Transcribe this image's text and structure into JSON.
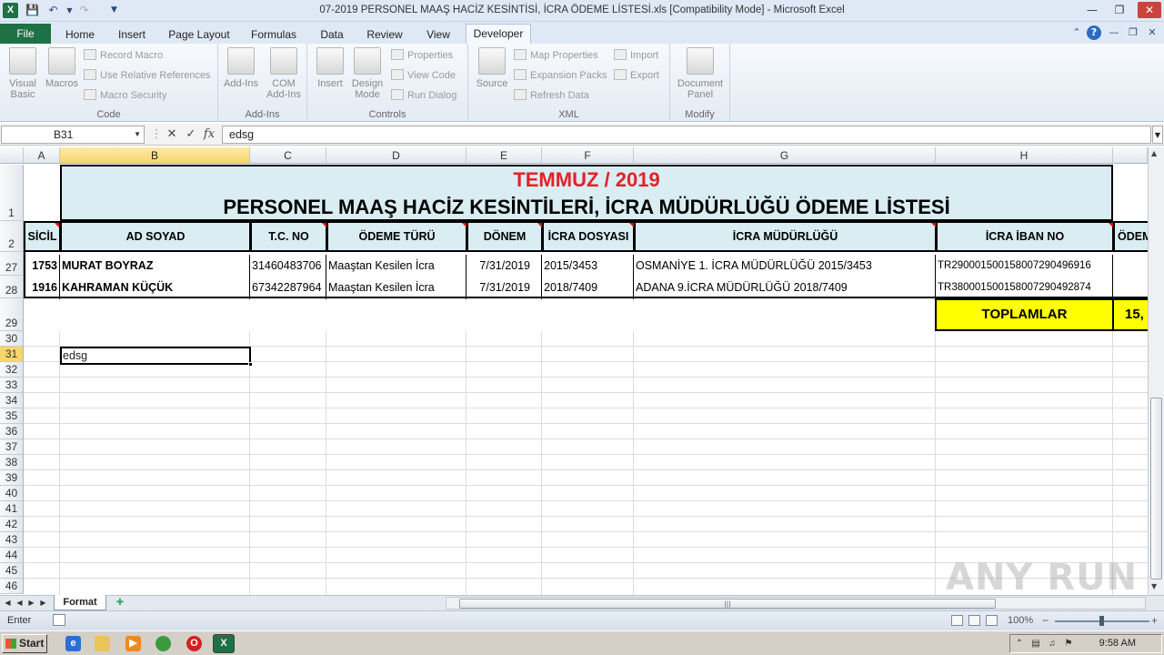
{
  "window": {
    "title": "07-2019 PERSONEL MAAŞ HACİZ KESİNTİSİ, İCRA ÖDEME LİSTESİ.xls  [Compatibility Mode]  -  Microsoft Excel",
    "app_icon": "X"
  },
  "tabs": {
    "file": "File",
    "items": [
      "Home",
      "Insert",
      "Page Layout",
      "Formulas",
      "Data",
      "Review",
      "View",
      "Developer"
    ],
    "active": "Developer"
  },
  "ribbon": {
    "code": {
      "label": "Code",
      "visual_basic": "Visual Basic",
      "macros": "Macros",
      "record_macro": "Record Macro",
      "use_relative": "Use Relative References",
      "macro_security": "Macro Security"
    },
    "addins": {
      "label": "Add-Ins",
      "addins": "Add-Ins",
      "com_addins": "COM Add-Ins"
    },
    "controls": {
      "label": "Controls",
      "insert": "Insert",
      "design_mode": "Design Mode",
      "properties": "Properties",
      "view_code": "View Code",
      "run_dialog": "Run Dialog"
    },
    "xml": {
      "label": "XML",
      "source": "Source",
      "map_properties": "Map Properties",
      "expansion_packs": "Expansion Packs",
      "refresh_data": "Refresh Data",
      "import": "Import",
      "export": "Export"
    },
    "modify": {
      "label": "Modify",
      "document_panel": "Document Panel"
    }
  },
  "formula_bar": {
    "name_box": "B31",
    "value": "edsg",
    "fx": "fx"
  },
  "columns": [
    "A",
    "B",
    "C",
    "D",
    "E",
    "F",
    "G",
    "H"
  ],
  "rows": [
    "1",
    "2",
    "27",
    "28",
    "29",
    "30",
    "31",
    "32",
    "33",
    "34",
    "35",
    "36",
    "37",
    "38",
    "39",
    "40",
    "41",
    "42",
    "43",
    "44",
    "45",
    "46"
  ],
  "sheet": {
    "title_line1": "TEMMUZ / 2019",
    "title_line2": "PERSONEL MAAŞ HACİZ KESİNTİLERİ, İCRA MÜDÜRLÜĞÜ ÖDEME LİSTESİ",
    "headers": [
      "SİCİL",
      "AD SOYAD",
      "T.C. NO",
      "ÖDEME TÜRÜ",
      "DÖNEM",
      "İCRA DOSYASI",
      "İCRA MÜDÜRLÜĞÜ",
      "İCRA İBAN NO",
      "ÖDEM"
    ],
    "rows": [
      [
        "1753",
        "MURAT BOYRAZ",
        "31460483706",
        "Maaştan Kesilen İcra",
        "7/31/2019",
        "2015/3453",
        "OSMANİYE 1. İCRA MÜDÜRLÜĞÜ 2015/3453",
        "TR290001500158007290496916"
      ],
      [
        "1916",
        "KAHRAMAN KÜÇÜK",
        "67342287964",
        "Maaştan Kesilen İcra",
        "7/31/2019",
        "2018/7409",
        "ADANA 9.İCRA MÜDÜRLÜĞÜ 2018/7409",
        "TR380001500158007290492874"
      ]
    ],
    "totals_label": "TOPLAMLAR",
    "totals_value": "15,",
    "active_cell_value": "edsg"
  },
  "sheet_tabs": {
    "active": "Format"
  },
  "status": {
    "mode": "Enter",
    "zoom": "100%"
  },
  "taskbar": {
    "start": "Start",
    "time": "9:58 AM"
  },
  "watermark": "ANY RUN"
}
